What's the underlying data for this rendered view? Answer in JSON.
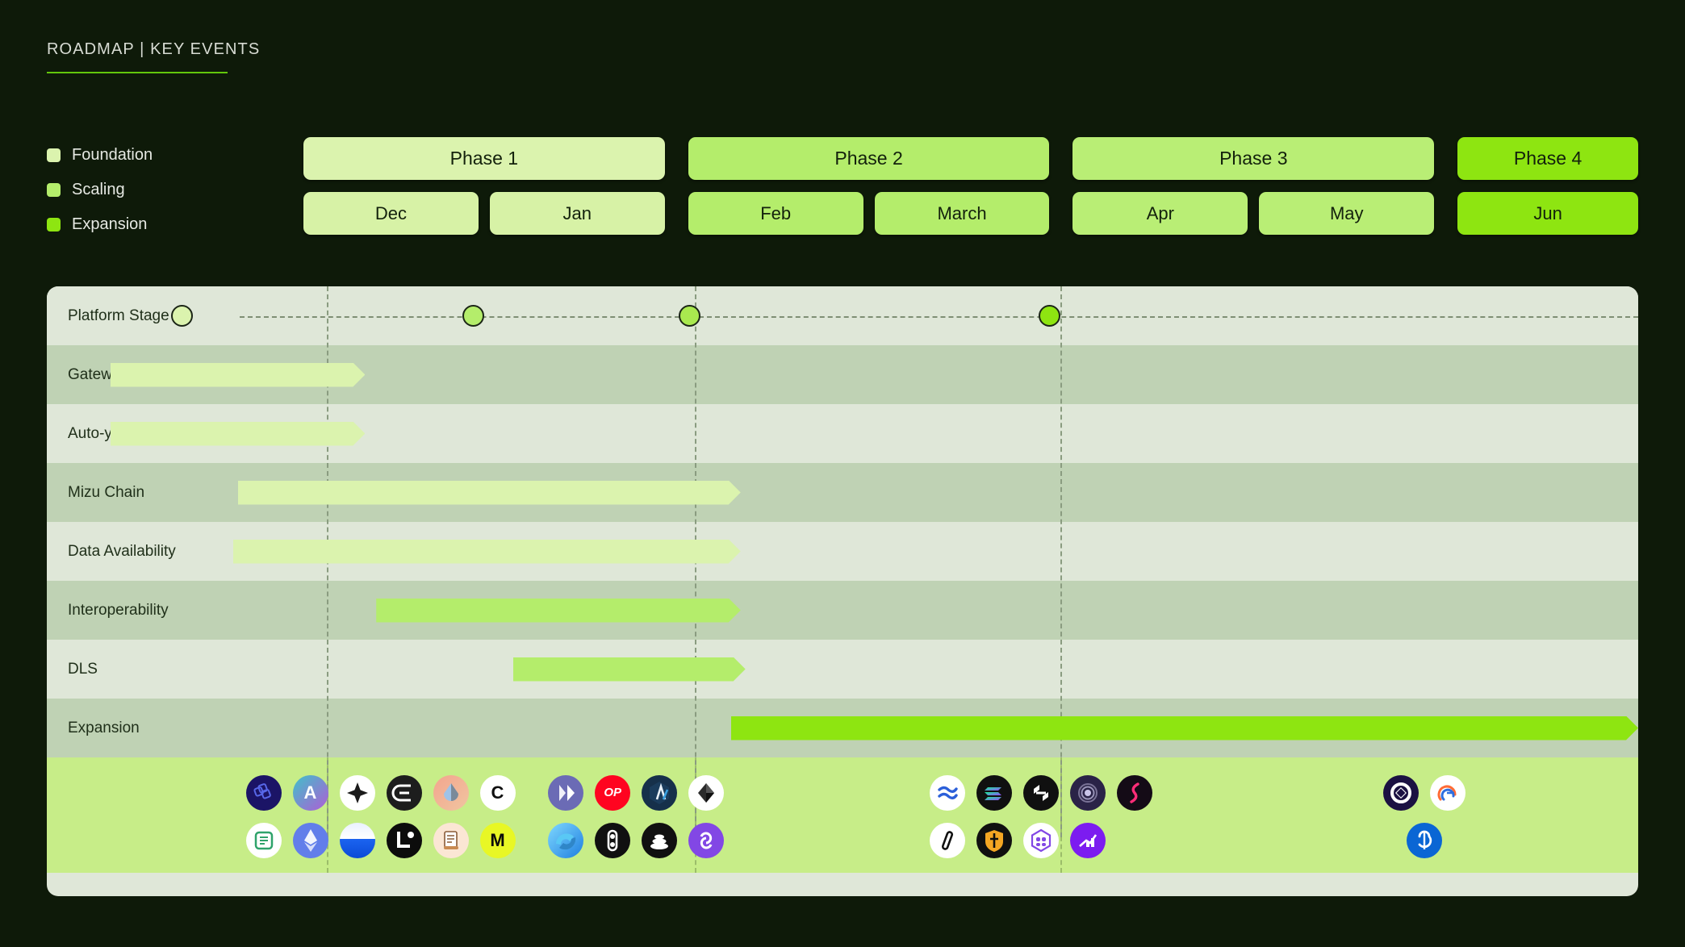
{
  "header": {
    "title": "ROADMAP | KEY EVENTS",
    "accent_color": "#63c60b"
  },
  "legend": {
    "items": [
      {
        "label": "Foundation",
        "color": "#dbf3ae"
      },
      {
        "label": "Scaling",
        "color": "#b4ed6b"
      },
      {
        "label": "Expansion",
        "color": "#8ee511"
      }
    ]
  },
  "timeline": {
    "phases": [
      {
        "label": "Phase 1",
        "color": "#dbf3ae",
        "months": [
          {
            "label": "Dec",
            "color": "#d7f2a6"
          },
          {
            "label": "Jan",
            "color": "#d7f2a6"
          }
        ]
      },
      {
        "label": "Phase 2",
        "color": "#b4ed6b",
        "months": [
          {
            "label": "Feb",
            "color": "#b4ed6b"
          },
          {
            "label": "March",
            "color": "#b4ed6b"
          }
        ]
      },
      {
        "label": "Phase 3",
        "color": "#b9ee75",
        "months": [
          {
            "label": "Apr",
            "color": "#b9ee75"
          },
          {
            "label": "May",
            "color": "#b9ee75"
          }
        ]
      },
      {
        "label": "Phase 4",
        "color": "#8ee511",
        "months": [
          {
            "label": "Jun",
            "color": "#8ee511"
          }
        ]
      }
    ]
  },
  "chart_data": {
    "type": "gantt",
    "title": "ROADMAP | KEY EVENTS",
    "x_axis": {
      "categories": [
        "Dec",
        "Jan",
        "Feb",
        "March",
        "Apr",
        "May",
        "Jun"
      ],
      "phase_groups": [
        "Phase 1",
        "Phase 2",
        "Phase 3",
        "Phase 4"
      ],
      "range_percent": [
        0,
        100
      ]
    },
    "grid": "vertical-dashed-phase-dividers",
    "phase_divider_percent": [
      17.6,
      40.7,
      63.7
    ],
    "rows": [
      {
        "label": "Platform Stage",
        "type": "milestones",
        "band": "odd",
        "milestones": [
          {
            "phase": "Phase 1",
            "x_percent": 8.5,
            "color": "#dbf3ae"
          },
          {
            "phase": "Phase 2",
            "x_percent": 26.8,
            "color": "#b4ed6b"
          },
          {
            "phase": "Phase 3",
            "x_percent": 40.4,
            "color": "#a9e94f"
          },
          {
            "phase": "Phase 4",
            "x_percent": 63.0,
            "color": "#8ee511"
          }
        ]
      },
      {
        "label": "Gateway",
        "type": "bar",
        "band": "even",
        "bar": {
          "start_percent": 4.0,
          "end_percent": 20.0,
          "color": "#dbf3ae",
          "phase": "Phase 1"
        }
      },
      {
        "label": "Auto-yield",
        "type": "bar",
        "band": "odd",
        "bar": {
          "start_percent": 4.0,
          "end_percent": 20.0,
          "color": "#dbf3ae",
          "phase": "Phase 1"
        }
      },
      {
        "label": "Mizu Chain",
        "type": "bar",
        "band": "even",
        "bar": {
          "start_percent": 12.0,
          "end_percent": 43.6,
          "color": "#dbf3ae",
          "phase": "Phase 1"
        }
      },
      {
        "label": "Data Availability",
        "type": "bar",
        "band": "odd",
        "bar": {
          "start_percent": 11.7,
          "end_percent": 43.6,
          "color": "#dbf3ae",
          "phase": "Phase 1"
        }
      },
      {
        "label": "Interoperability",
        "type": "bar",
        "band": "even",
        "bar": {
          "start_percent": 20.7,
          "end_percent": 43.6,
          "color": "#b4ed6b",
          "phase": "Phase 2"
        }
      },
      {
        "label": "DLS",
        "type": "bar",
        "band": "odd",
        "bar": {
          "start_percent": 29.3,
          "end_percent": 43.9,
          "color": "#b4ed6b",
          "phase": "Phase 2"
        }
      },
      {
        "label": "Expansion",
        "type": "bar",
        "band": "even",
        "bar": {
          "start_percent": 43.0,
          "end_percent": 100.0,
          "color": "#8ee511",
          "phase": "Phase 3"
        }
      }
    ]
  },
  "partners": {
    "groups": [
      {
        "phase": "Phase 1",
        "left_percent": 12.5,
        "rows": [
          [
            {
              "name": "nillion-icon",
              "bg": "#1b1466",
              "fg": "#5b6cf0",
              "glyph": "",
              "shape": "nillion"
            },
            {
              "name": "arbitrum-a-icon",
              "bg": "linear-gradient(135deg,#3fc1c9,#b05cd6)",
              "fg": "#ffffff",
              "glyph": "A",
              "shape": "letter"
            },
            {
              "name": "diamond-icon",
              "bg": "#ffffff",
              "fg": "#1b1b1b",
              "glyph": "",
              "shape": "diamond-star"
            },
            {
              "name": "ethena-icon",
              "bg": "#1d1d1d",
              "fg": "#ffffff",
              "glyph": "",
              "shape": "ethena"
            },
            {
              "name": "lido-drop-icon",
              "bg": "linear-gradient(135deg,#f3a58e,#f0c5a0)",
              "fg": "#6fa8dc",
              "glyph": "",
              "shape": "droplet"
            },
            {
              "name": "celo-c-icon",
              "bg": "#ffffff",
              "fg": "#101010",
              "glyph": "C",
              "shape": "letter"
            }
          ],
          [
            {
              "name": "notes-icon",
              "bg": "#ffffff",
              "fg": "#2fa36b",
              "glyph": "",
              "shape": "square-note"
            },
            {
              "name": "ethereum-icon",
              "bg": "#627eea",
              "fg": "#ffffff",
              "glyph": "",
              "shape": "ethereum"
            },
            {
              "name": "base-icon",
              "bg": "linear-gradient(180deg,#e9f1ff 0%,#ffffff 45%,#1b63f0 46%,#0b4bd6 100%)",
              "fg": "#ffffff",
              "glyph": "",
              "shape": "plain"
            },
            {
              "name": "linea-l-icon",
              "bg": "#0c0c0c",
              "fg": "#ffffff",
              "glyph": "",
              "shape": "linea"
            },
            {
              "name": "scroll-icon",
              "bg": "#fbe6d4",
              "fg": "#8a5a36",
              "glyph": "",
              "shape": "scroll"
            },
            {
              "name": "moonbeam-m-icon",
              "bg": "#e8f725",
              "fg": "#0b0b0b",
              "glyph": "M",
              "shape": "letter"
            }
          ]
        ]
      },
      {
        "phase": "Phase 2",
        "left_percent": 31.5,
        "rows": [
          [
            {
              "name": "sui-icon",
              "bg": "#6b6bb5",
              "fg": "#ffffff",
              "glyph": "",
              "shape": "play-split"
            },
            {
              "name": "optimism-icon",
              "bg": "#ff0420",
              "fg": "#ffffff",
              "glyph": "OP",
              "shape": "letter-op"
            },
            {
              "name": "arbitrum-icon",
              "bg": "#16304a",
              "fg": "#96bedc",
              "glyph": "",
              "shape": "arbitrum"
            },
            {
              "name": "starknet-icon",
              "bg": "#ffffff",
              "fg": "#1b1b1b",
              "glyph": "",
              "shape": "gem"
            }
          ],
          [
            {
              "name": "swirl-icon",
              "bg": "linear-gradient(135deg,#7fd8ff,#1f7fe0)",
              "fg": "#ffffff",
              "glyph": "",
              "shape": "swirl"
            },
            {
              "name": "chain-link-icon",
              "bg": "#101010",
              "fg": "#ffffff",
              "glyph": "",
              "shape": "chain"
            },
            {
              "name": "stack-icon",
              "bg": "#101010",
              "fg": "#ffffff",
              "glyph": "",
              "shape": "stack"
            },
            {
              "name": "polygon-icon",
              "bg": "#8247e5",
              "fg": "#ffffff",
              "glyph": "",
              "shape": "polygon"
            }
          ]
        ]
      },
      {
        "phase": "Phase 3",
        "left_percent": 55.5,
        "rows": [
          [
            {
              "name": "sei-icon",
              "bg": "#ffffff",
              "fg": "#2b5fd9",
              "glyph": "",
              "shape": "waves"
            },
            {
              "name": "solana-icon",
              "bg": "#101010",
              "fg": "#14f195",
              "glyph": "",
              "shape": "solana"
            },
            {
              "name": "near-icon",
              "bg": "#101010",
              "fg": "#ffffff",
              "glyph": "",
              "shape": "near"
            },
            {
              "name": "rings-icon",
              "bg": "#2a2347",
              "fg": "#c9c4e8",
              "glyph": "",
              "shape": "rings"
            },
            {
              "name": "zeta-icon",
              "bg": "#140b16",
              "fg": "#ff2d78",
              "glyph": "",
              "shape": "zigzag"
            }
          ],
          [
            {
              "name": "pencil-icon",
              "bg": "#ffffff",
              "fg": "#101010",
              "glyph": "",
              "shape": "pencil"
            },
            {
              "name": "shield-icon",
              "bg": "#101010",
              "fg": "#f5a623",
              "glyph": "",
              "shape": "shield"
            },
            {
              "name": "hex-mask-icon",
              "bg": "#ffffff",
              "fg": "#8247e5",
              "glyph": "",
              "shape": "hex-mask"
            },
            {
              "name": "chart-icon",
              "bg": "#7c1cf0",
              "fg": "#ffffff",
              "glyph": "",
              "shape": "chart"
            }
          ]
        ]
      },
      {
        "phase": "Phase 4",
        "left_percent": 84.0,
        "rows": [
          [
            {
              "name": "maker-icon",
              "bg": "#1b1142",
              "fg": "#ffffff",
              "glyph": "",
              "shape": "ring-diamond"
            },
            {
              "name": "aave-icon",
              "bg": "#ffffff",
              "fg": "#2f6fe0",
              "glyph": "",
              "shape": "aave"
            }
          ],
          [
            {
              "name": "yearn-icon",
              "bg": "#0a66d4",
              "fg": "#ffffff",
              "glyph": "",
              "shape": "yearn"
            }
          ]
        ]
      }
    ]
  }
}
